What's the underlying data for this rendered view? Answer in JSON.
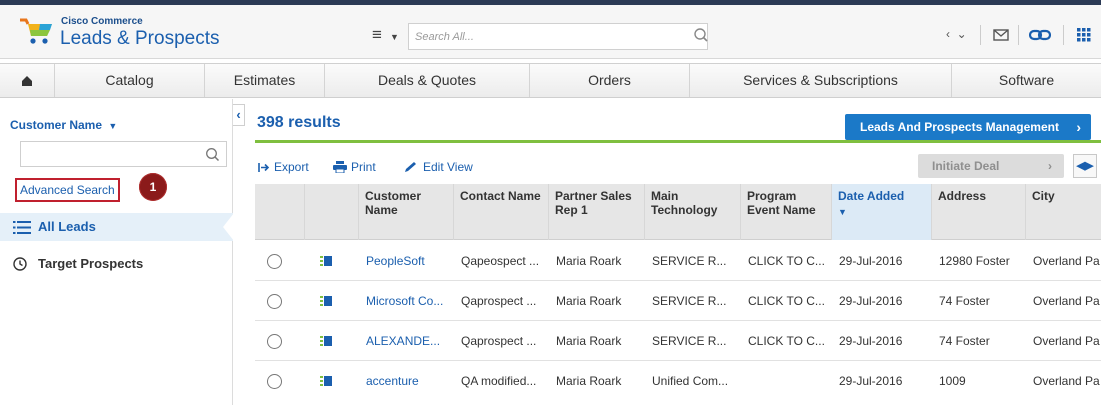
{
  "colors": {
    "brand": "#1b5fae",
    "accent_green": "#7fbf3f",
    "primary_button": "#1b79c8",
    "badge": "#8b1a1a",
    "highlight_border": "#c0202e"
  },
  "header": {
    "brand_small": "Cisco Commerce",
    "brand_title": "Leads & Prospects",
    "search_placeholder": "Search All...",
    "icons": [
      "menu-icon",
      "search-icon",
      "user-caret-icon",
      "mail-icon",
      "link-icon",
      "apps-grid-icon"
    ]
  },
  "nav": {
    "items": [
      {
        "label": ""
      },
      {
        "label": "Catalog"
      },
      {
        "label": "Estimates"
      },
      {
        "label": "Deals & Quotes"
      },
      {
        "label": "Orders"
      },
      {
        "label": "Services & Subscriptions"
      },
      {
        "label": "Software"
      }
    ]
  },
  "sidebar": {
    "filter_title": "Customer Name",
    "advanced_search": "Advanced Search",
    "badge": "1",
    "items": [
      {
        "label": "All Leads",
        "icon": "list-icon",
        "selected": true
      },
      {
        "label": "Target Prospects",
        "icon": "clock-icon",
        "selected": false
      }
    ]
  },
  "main": {
    "results": "398 results",
    "management_button": "Leads And Prospects Management",
    "toolbar": {
      "export": "Export",
      "print": "Print",
      "edit_view": "Edit View",
      "initiate_deal": "Initiate Deal"
    }
  },
  "table": {
    "columns": [
      {
        "label": ""
      },
      {
        "label": ""
      },
      {
        "label": "Customer Name"
      },
      {
        "label": "Contact Name"
      },
      {
        "label": "Partner Sales Rep 1"
      },
      {
        "label": "Main Technology"
      },
      {
        "label": "Program Event Name"
      },
      {
        "label": "Date Added",
        "sorted": "desc"
      },
      {
        "label": "Address"
      },
      {
        "label": "City"
      }
    ],
    "rows": [
      {
        "customer": "PeopleSoft",
        "contact": "Qapeospect ...",
        "rep": "Maria Roark",
        "tech": "SERVICE R...",
        "event": "CLICK TO C...",
        "date": "29-Jul-2016",
        "address": "12980 Foster",
        "city": "Overland Pa"
      },
      {
        "customer": "Microsoft Co...",
        "contact": "Qaprospect ...",
        "rep": "Maria Roark",
        "tech": "SERVICE R...",
        "event": "CLICK TO C...",
        "date": "29-Jul-2016",
        "address": "74 Foster",
        "city": "Overland Pa"
      },
      {
        "customer": "ALEXANDE...",
        "contact": "Qaprospect ...",
        "rep": "Maria Roark",
        "tech": "SERVICE R...",
        "event": "CLICK TO C...",
        "date": "29-Jul-2016",
        "address": "74 Foster",
        "city": "Overland Pa"
      },
      {
        "customer": "accenture",
        "contact": "QA modified...",
        "rep": "Maria Roark",
        "tech": "Unified Com...",
        "event": "",
        "date": "29-Jul-2016",
        "address": "1009",
        "city": "Overland Pa"
      }
    ]
  }
}
